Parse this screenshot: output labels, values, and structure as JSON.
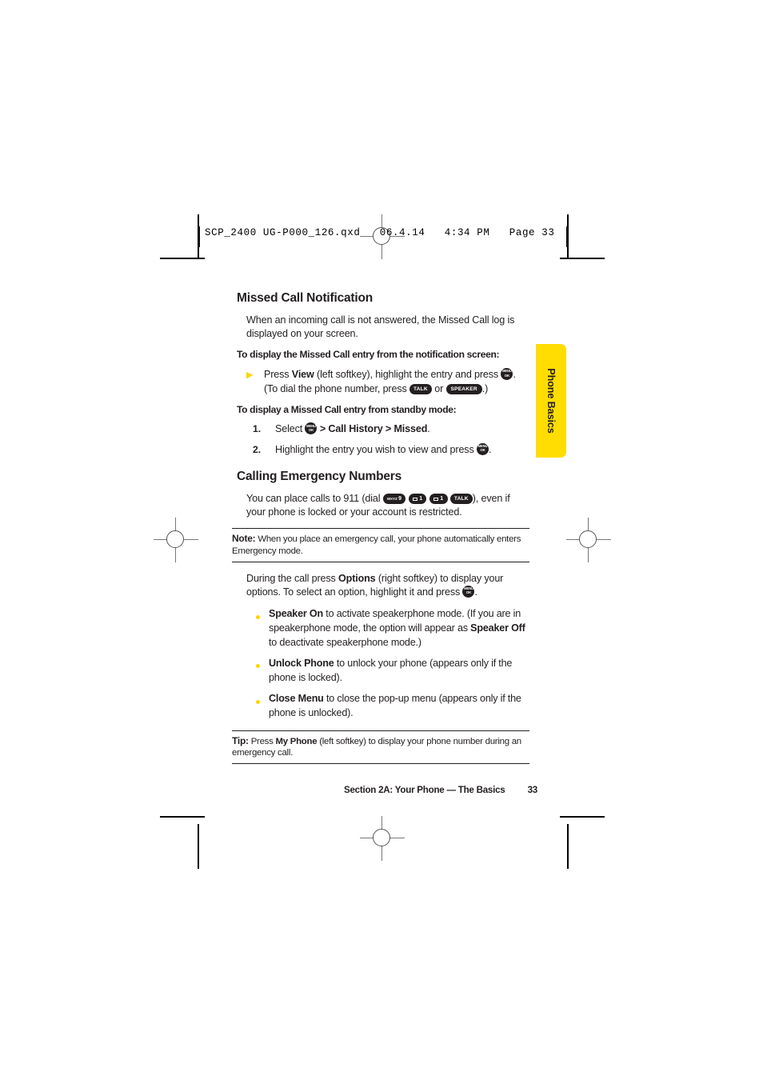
{
  "print_slug": "SCP_2400 UG-P000_126.qxd   06.4.14   4:34 PM   Page 33",
  "side_tab": {
    "label": "Phone Basics",
    "color": "#ffdd00"
  },
  "sections": {
    "missed_call": {
      "heading": "Missed Call Notification",
      "intro": "When an incoming call is not answered, the Missed Call log is displayed on your screen.",
      "lead_in_1": "To display the Missed Call entry from the notification screen:",
      "arrow_item_line1_a": "Press ",
      "arrow_item_line1_b": "View",
      "arrow_item_line1_c": " (left softkey), highlight the entry and press",
      "arrow_item_line2_a": ". (To dial the phone number, press",
      "arrow_item_line2_b": "or",
      "arrow_item_line2_c": ".)",
      "lead_in_2": "To display a Missed Call entry from standby mode:",
      "step1_num": "1.",
      "step1_a": "Select",
      "step1_b": "> Call History > Missed",
      "step1_c": ".",
      "step2_num": "2.",
      "step2_a": "Highlight the entry you wish to view and press",
      "step2_b": "."
    },
    "emergency": {
      "heading": "Calling Emergency Numbers",
      "intro_a": "You can place calls to 911 (dial",
      "intro_b": "), even if your phone is locked or your account is restricted.",
      "note": {
        "label": "Note:",
        "text": "When you place an emergency call, your phone automatically enters Emergency mode."
      },
      "options_intro_a": "During the call press ",
      "options_intro_b": "Options",
      "options_intro_c": " (right softkey) to display your options. To select an option, highlight it and press",
      "options_intro_d": ".",
      "bullets": [
        {
          "term": "Speaker On",
          "text_a": " to activate speakerphone mode. (If you are in speakerphone mode, the option will appear as ",
          "term2": "Speaker Off",
          "text_b": " to deactivate speakerphone mode.)"
        },
        {
          "term": "Unlock Phone",
          "text_a": " to unlock your phone (appears only if the phone is locked).",
          "term2": "",
          "text_b": ""
        },
        {
          "term": "Close Menu",
          "text_a": " to close the pop-up menu (appears only if the phone is unlocked).",
          "term2": "",
          "text_b": ""
        }
      ],
      "tip": {
        "label": "Tip:",
        "text_a": "Press ",
        "term": "My Phone",
        "text_b": " (left softkey) to display your phone number during an emergency call."
      }
    }
  },
  "keys": {
    "menu_ok_top": "MENU",
    "menu_ok_bottom": "OK",
    "talk": "TALK",
    "speaker": "SPEAKER",
    "nine_sub": "WXYZ",
    "nine_digit": "9",
    "one_digit": "1"
  },
  "footer": {
    "section": "Section 2A: Your Phone — The Basics",
    "page_number": "33"
  }
}
